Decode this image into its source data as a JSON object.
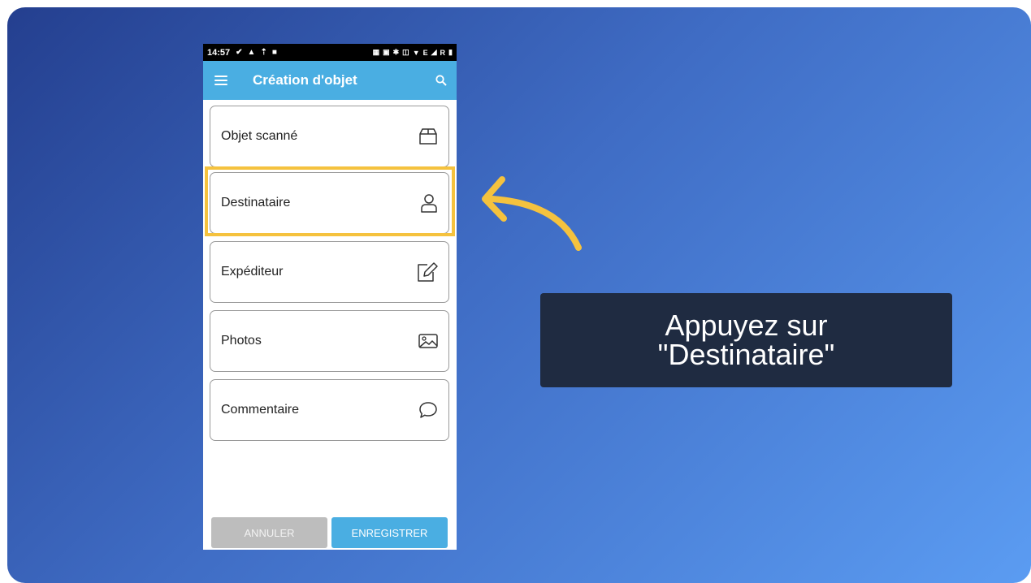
{
  "status_bar": {
    "time": "14:57",
    "left_icons": [
      "check-circle-icon",
      "warning-icon",
      "upload-icon",
      "video-icon"
    ],
    "right_icons": [
      "nfc-icon",
      "cast-icon",
      "bluetooth-icon",
      "vibrate-icon",
      "wifi-icon",
      "signal-icon",
      "battery-icon"
    ],
    "network_label": "E",
    "roaming_label": "R"
  },
  "app_bar": {
    "title": "Création d'objet",
    "menu_icon": "menu-icon",
    "search_icon": "search-icon",
    "color": "#4aaee2"
  },
  "items": [
    {
      "label": "Objet scanné",
      "icon": "box-icon"
    },
    {
      "label": "Destinataire",
      "icon": "user-icon"
    },
    {
      "label": "Expéditeur",
      "icon": "edit-icon"
    },
    {
      "label": "Photos",
      "icon": "image-icon"
    },
    {
      "label": "Commentaire",
      "icon": "comment-icon"
    }
  ],
  "highlighted_item": "Destinataire",
  "highlight_color": "#f5c23e",
  "buttons": {
    "cancel": "ANNULER",
    "save": "ENREGISTRER"
  },
  "callout": {
    "line1": "Appuyez sur",
    "line2": "\"Destinataire\""
  }
}
